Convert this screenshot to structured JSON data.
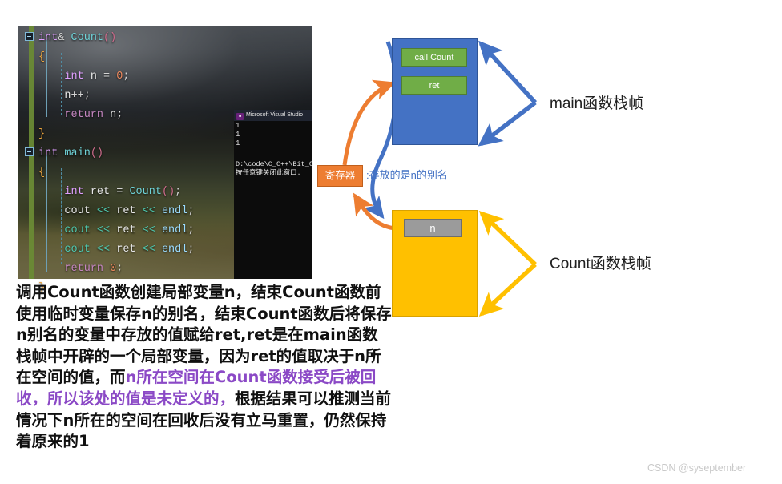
{
  "code_editor": {
    "lines": [
      [
        {
          "t": "int",
          "c": "typ"
        },
        {
          "t": "& ",
          "c": "op"
        },
        {
          "t": "Count",
          "c": "fn"
        },
        {
          "t": "()",
          "c": "paren"
        }
      ],
      [
        {
          "t": "{",
          "c": "brc"
        }
      ],
      [
        {
          "t": "    int",
          "c": "typ"
        },
        {
          "t": " n ",
          "c": "plain"
        },
        {
          "t": "= ",
          "c": "op"
        },
        {
          "t": "0",
          "c": "num"
        },
        {
          "t": ";",
          "c": "pun"
        }
      ],
      [
        {
          "t": "    n",
          "c": "plain"
        },
        {
          "t": "++;",
          "c": "pun"
        }
      ],
      [
        {
          "t": "    return",
          "c": "kw"
        },
        {
          "t": " n;",
          "c": "plain"
        }
      ],
      [
        {
          "t": "}",
          "c": "brc"
        }
      ],
      [
        {
          "t": "int",
          "c": "typ"
        },
        {
          "t": " ",
          "c": "plain"
        },
        {
          "t": "main",
          "c": "fn"
        },
        {
          "t": "()",
          "c": "paren"
        }
      ],
      [
        {
          "t": "{",
          "c": "brc"
        }
      ],
      [
        {
          "t": "    int",
          "c": "typ"
        },
        {
          "t": " ret ",
          "c": "plain"
        },
        {
          "t": "= ",
          "c": "op"
        },
        {
          "t": "Count",
          "c": "fn"
        },
        {
          "t": "()",
          "c": "paren"
        },
        {
          "t": ";",
          "c": "pun"
        }
      ],
      [
        {
          "t": "    cout",
          "c": "plain"
        },
        {
          "t": " << ",
          "c": "strm"
        },
        {
          "t": "ret",
          "c": "plain"
        },
        {
          "t": " << ",
          "c": "strm"
        },
        {
          "t": "endl",
          "c": "var"
        },
        {
          "t": ";",
          "c": "pun"
        }
      ],
      [
        {
          "t": "    cout",
          "c": "strm"
        },
        {
          "t": " << ",
          "c": "strm"
        },
        {
          "t": "ret",
          "c": "plain"
        },
        {
          "t": " << ",
          "c": "strm"
        },
        {
          "t": "endl",
          "c": "var"
        },
        {
          "t": ";",
          "c": "pun"
        }
      ],
      [
        {
          "t": "    cout",
          "c": "strm"
        },
        {
          "t": " << ",
          "c": "strm"
        },
        {
          "t": "ret",
          "c": "plain"
        },
        {
          "t": " << ",
          "c": "strm"
        },
        {
          "t": "endl",
          "c": "var"
        },
        {
          "t": ";",
          "c": "pun"
        }
      ],
      [
        {
          "t": "    return",
          "c": "kw"
        },
        {
          "t": " ",
          "c": "plain"
        },
        {
          "t": "0",
          "c": "num"
        },
        {
          "t": ";",
          "c": "pun"
        }
      ],
      [
        {
          "t": "}",
          "c": "brc"
        }
      ]
    ],
    "fold_markers": [
      0,
      6
    ]
  },
  "console": {
    "title": "Microsoft Visual Studio",
    "icon": "vs-console-icon",
    "output": "1\n1\n1",
    "path_line": "D:\\code\\C_C++\\Bit_C",
    "prompt_line": "按任意键关闭此窗口."
  },
  "diagram": {
    "main_frame": {
      "chips": [
        "call Count",
        "ret"
      ],
      "label": "main函数栈帧",
      "color": "#4472C4",
      "chip_color": "#70AD47"
    },
    "count_frame": {
      "chips": [
        "n"
      ],
      "label": "Count函数栈帧",
      "color": "#FFC000",
      "chip_color": "#9b9b9b"
    },
    "register": {
      "label": "寄存器",
      "note": ":存放的是n的别名",
      "box_color": "#ED7D31",
      "note_color": "#4472C4"
    }
  },
  "explanation": {
    "segments": [
      {
        "text": "调用Count函数创建局部变量n，结束Count函数前使用临时变量保存n的别名，结束Count函数后将保存n别名的变量中存放的值赋给ret,ret是在main函数栈帧中开辟的一个局部变量，因为ret的值取决于n所在空间的值，而",
        "highlight": false
      },
      {
        "text": "n所在空间在Count函数接受后被回收，所以该处的值是未定义的，",
        "highlight": true
      },
      {
        "text": "根据结果可以推测当前情况下n所在的空间在回收后没有立马重置，仍然保持着原来的1",
        "highlight": false
      }
    ],
    "highlight_color": "#8B49C6"
  },
  "watermark": "CSDN @syseptember"
}
